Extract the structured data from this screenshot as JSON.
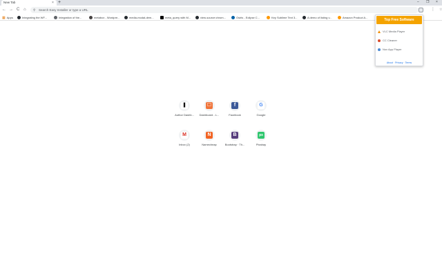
{
  "browser": {
    "tab_title": "New Tab",
    "tab_close": "×",
    "new_tab": "+",
    "window_controls": [
      "–",
      "❐",
      "×"
    ]
  },
  "toolbar": {
    "back": "←",
    "forward": "→",
    "reload": "C",
    "home": "⌂",
    "omnibox_placeholder": "Search Easy Installer or type a URL",
    "star": "☆",
    "menu": "⋮"
  },
  "bookmarks": [
    {
      "label": "Apps",
      "icon": "apps-icon"
    },
    {
      "label": "Integrating the WF...",
      "icon": "github-icon"
    },
    {
      "label": "Integration of the...",
      "icon": "so-icon"
    },
    {
      "label": "metabox - Wordpre...",
      "icon": "wordpress-icon"
    },
    {
      "label": "media-modal-dem...",
      "icon": "github-icon"
    },
    {
      "label": "meta_query with M...",
      "icon": "square-icon"
    },
    {
      "label": "view-source:chrom...",
      "icon": "github-icon"
    },
    {
      "label": "Osiris - Eclipse C...",
      "icon": "globe-icon"
    },
    {
      "label": "Key Sublime Text 3...",
      "icon": "sublime-icon"
    },
    {
      "label": "A demo of listing v...",
      "icon": "github-icon"
    },
    {
      "label": "Amazon Product A...",
      "icon": "amazon-icon"
    }
  ],
  "shortcuts": [
    {
      "label": "Author Dashb...",
      "glyph": "❚",
      "bg": "#ffffff",
      "fg": "#111111"
    },
    {
      "label": "Dashboard - L...",
      "glyph": "☐",
      "bg": "#f0743a",
      "fg": "#ffffff"
    },
    {
      "label": "Facebook",
      "glyph": "f",
      "bg": "#3b5998",
      "fg": "#ffffff"
    },
    {
      "label": "Google",
      "glyph": "G",
      "bg": "#ffffff",
      "fg": "#4285f4"
    },
    {
      "label": "Inbox (2)",
      "glyph": "M",
      "bg": "#ffffff",
      "fg": "#d93025"
    },
    {
      "label": "Namecheap",
      "glyph": "N",
      "bg": "#f26322",
      "fg": "#ffffff"
    },
    {
      "label": "Bootstrap · Th...",
      "glyph": "B",
      "bg": "#563d7c",
      "fg": "#ffffff"
    },
    {
      "label": "Pixabay",
      "glyph": "px",
      "bg": "#2ec66d",
      "fg": "#ffffff"
    }
  ],
  "popup": {
    "title": "Top Free Software",
    "header_color": "#f4a300",
    "items": [
      {
        "label": "VLC Media Player",
        "icon": "vlc-icon",
        "color": "#f08c00"
      },
      {
        "label": "CC Cleaner",
        "icon": "ccleaner-icon",
        "color": "#d94b2b"
      },
      {
        "label": "Nox App Player",
        "icon": "nox-icon",
        "color": "#4a8ad4"
      }
    ],
    "footer": [
      "About",
      "Privacy",
      "Terms"
    ]
  }
}
